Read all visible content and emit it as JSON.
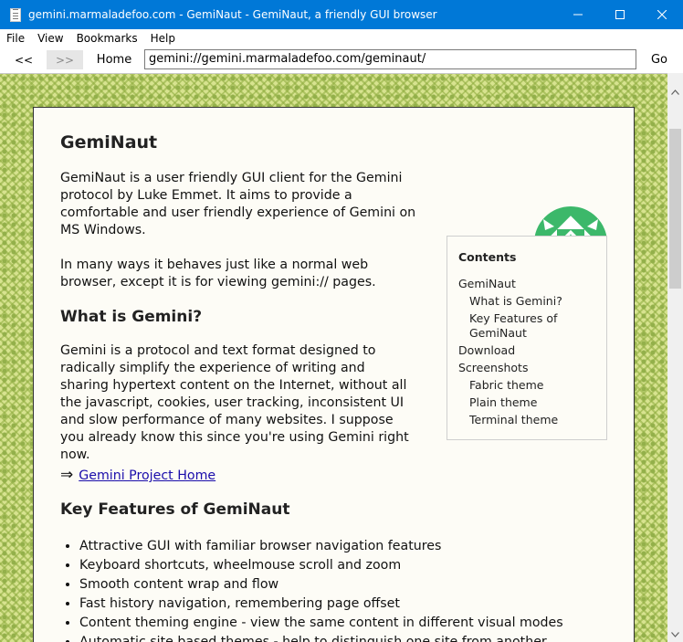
{
  "window": {
    "title": "gemini.marmaladefoo.com - GemiNaut - GemiNaut, a friendly GUI browser"
  },
  "menu": [
    "File",
    "View",
    "Bookmarks",
    "Help"
  ],
  "toolbar": {
    "back_label": "<<",
    "forward_label": ">>",
    "home_label": "Home",
    "address_value": "gemini://gemini.marmaladefoo.com/geminaut/",
    "go_label": "Go"
  },
  "page": {
    "title": "GemiNaut",
    "intro": "GemiNaut is a user friendly GUI client for the Gemini protocol by Luke Emmet. It aims to provide a comfortable and user friendly experience of Gemini on MS Windows.",
    "intro2": "In many ways it behaves just like a normal web browser, except it is for viewing gemini:// pages.",
    "what_heading": "What is Gemini?",
    "what_text": "Gemini is a protocol and text format designed to radically simplify the experience of writing and sharing hypertext content on the Internet, without all the javascript, cookies, user tracking, inconsistent UI and slow performance of many websites. I suppose you already know this since you're using Gemini right now.",
    "link_arrow": "⇒",
    "link_text": "Gemini Project Home",
    "features_heading": "Key Features of GemiNaut",
    "features": [
      "Attractive GUI with familiar browser navigation features",
      "Keyboard shortcuts, wheelmouse scroll and zoom",
      "Smooth content wrap and flow",
      "Fast history navigation, remembering page offset",
      "Content theming engine - view the same content in different visual modes",
      "Automatic site based themes - help to distinguish one site from another"
    ]
  },
  "contents": {
    "heading": "Contents",
    "items": [
      {
        "label": "GemiNaut",
        "level": 1
      },
      {
        "label": "What is Gemini?",
        "level": 2
      },
      {
        "label": "Key Features of GemiNaut",
        "level": 2
      },
      {
        "label": "Download",
        "level": 1
      },
      {
        "label": "Screenshots",
        "level": 1
      },
      {
        "label": "Fabric theme",
        "level": 2
      },
      {
        "label": "Plain theme",
        "level": 2
      },
      {
        "label": "Terminal theme",
        "level": 2
      }
    ]
  },
  "colors": {
    "titlebar": "#0078d7",
    "link": "#1a0dab",
    "page_bg": "#fdfcf6",
    "logo_green": "#3cb86a"
  }
}
